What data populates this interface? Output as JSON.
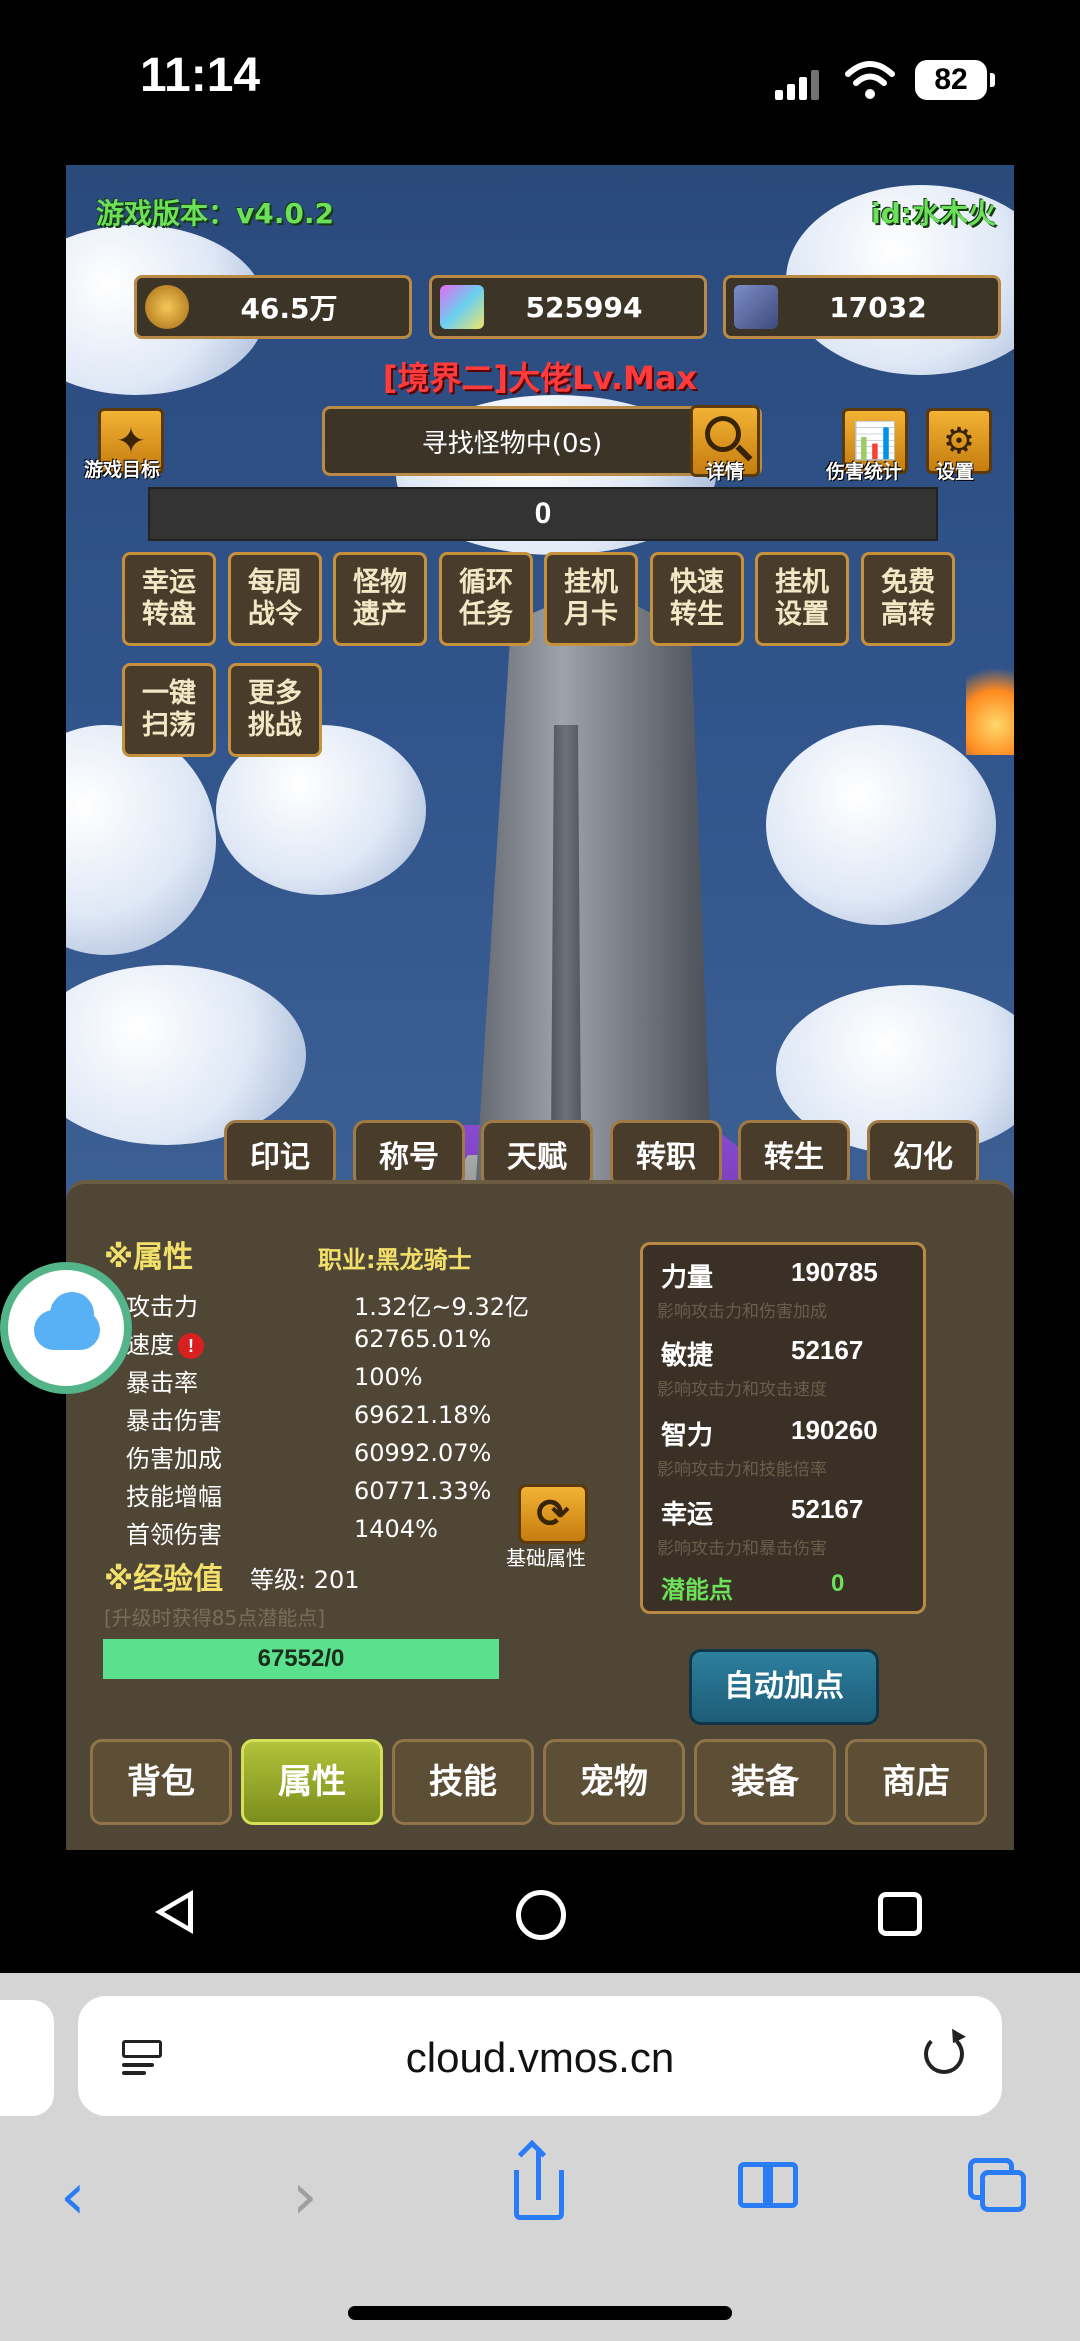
{
  "status": {
    "time": "11:14",
    "battery": "82"
  },
  "game": {
    "version": "游戏版本：v4.0.2",
    "user_id": "id:水木火",
    "resources": [
      {
        "icon": "coin-icon",
        "value": "46.5万"
      },
      {
        "icon": "crystal-icon",
        "value": "525994"
      },
      {
        "icon": "card-icon",
        "value": "17032"
      }
    ],
    "realm_title": "[境界二]大佬Lv.Max",
    "goal_label": "游戏目标",
    "search_text": "寻找怪物中(0s)",
    "detail_label": "详情",
    "damage_stats_label": "伤害统计",
    "settings_label": "设置",
    "progress_value": "0",
    "activities": [
      {
        "line1": "幸运",
        "line2": "转盘"
      },
      {
        "line1": "每周",
        "line2": "战令"
      },
      {
        "line1": "怪物",
        "line2": "遗产"
      },
      {
        "line1": "循环",
        "line2": "任务"
      },
      {
        "line1": "挂机",
        "line2": "月卡"
      },
      {
        "line1": "快速",
        "line2": "转生"
      },
      {
        "line1": "挂机",
        "line2": "设置"
      },
      {
        "line1": "免费",
        "line2": "高转"
      },
      {
        "line1": "一键",
        "line2": "扫荡"
      },
      {
        "line1": "更多",
        "line2": "挑战"
      }
    ],
    "subtabs": [
      "印记",
      "称号",
      "天赋",
      "转职",
      "转生",
      "幻化"
    ],
    "panel": {
      "attr_header": "※属性",
      "job": "职业:黑龙骑士",
      "stats": [
        {
          "name": "攻击力",
          "value": "1.32亿~9.32亿"
        },
        {
          "name": "速度",
          "value": "62765.01%"
        },
        {
          "name": "暴击率",
          "value": "100%"
        },
        {
          "name": "暴击伤害",
          "value": "69621.18%"
        },
        {
          "name": "伤害加成",
          "value": "60992.07%"
        },
        {
          "name": "技能增幅",
          "value": "60771.33%"
        },
        {
          "name": "首领伤害",
          "value": "1404%"
        }
      ],
      "warning_mark": "!",
      "exp_header": "※经验值",
      "level": "等级: 201",
      "level_hint": "[升级时获得85点潜能点]",
      "exp_value": "67552/0",
      "base_attr_label": "基础属性",
      "attributes": [
        {
          "name": "力量",
          "value": "190785",
          "desc": "影响攻击力和伤害加成"
        },
        {
          "name": "敏捷",
          "value": "52167",
          "desc": "影响攻击力和攻击速度"
        },
        {
          "name": "智力",
          "value": "190260",
          "desc": "影响攻击力和技能倍率"
        },
        {
          "name": "幸运",
          "value": "52167",
          "desc": "影响攻击力和暴击伤害"
        }
      ],
      "potential_label": "潜能点",
      "potential_value": "0",
      "auto_button": "自动加点"
    },
    "nav_tabs": [
      "背包",
      "属性",
      "技能",
      "宠物",
      "装备",
      "商店"
    ],
    "active_tab": "属性"
  },
  "browser": {
    "url": "cloud.vmos.cn"
  },
  "colors": {
    "accent_green": "#6de05a",
    "realm_red": "#ff3b3b",
    "safari_blue": "#2a7cf6",
    "exp_bar": "#5be08e"
  }
}
